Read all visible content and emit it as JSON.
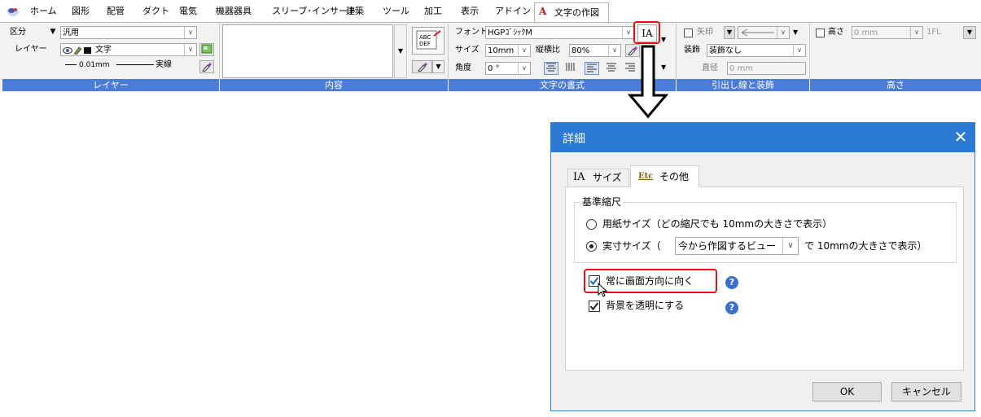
{
  "menu": {
    "tabs": [
      "ホーム",
      "図形",
      "配管",
      "ダクト",
      "電気",
      "機器器具",
      "スリーブ･インサート",
      "建築",
      "ツール",
      "加工",
      "表示",
      "アドイン"
    ],
    "active_tab_icon": "A",
    "active_tab": "文字の作図"
  },
  "ribbon": {
    "layer": {
      "kubun_label": "区分",
      "kubun_value": "汎用",
      "layer_label": "レイヤー",
      "layer_value": "文字",
      "line_width": "0.01mm",
      "line_type": "実線",
      "footer": "レイヤー"
    },
    "content": {
      "footer": "内容",
      "abc_icon_text": "ABC DEF"
    },
    "format": {
      "font_label": "フォント",
      "font_value": "HGPｺﾞｼｯｸM",
      "size_label": "サイズ",
      "size_value": "10mm",
      "ratio_label": "縦横比",
      "ratio_value": "80%",
      "angle_label": "角度",
      "angle_value": "0 °",
      "detail_button": "IA",
      "footer": "文字の書式"
    },
    "leader": {
      "arrow_label": "矢印",
      "deco_label": "装飾",
      "deco_value": "装飾なし",
      "diameter_label": "直径",
      "diameter_value": "0 mm",
      "footer": "引出し線と装飾"
    },
    "height": {
      "label": "高さ",
      "value": "0 mm",
      "floor": "1FL",
      "footer": "高さ"
    }
  },
  "dialog": {
    "title": "詳細",
    "close": "✕",
    "tab_size_icon": "IA",
    "tab_size": "サイズ",
    "tab_other_icon": "Etc",
    "tab_other": "その他",
    "group_title": "基準縮尺",
    "radio1": "用紙サイズ（どの縮尺でも 10mmの大きさで表示）",
    "radio2_prefix": "実寸サイズ（",
    "radio2_select": "今から作図するビュー",
    "radio2_suffix": "で 10mmの大きさで表示）",
    "check1": "常に画面方向に向く",
    "check2": "背景を透明にする",
    "help": "?",
    "ok": "OK",
    "cancel": "キャンセル"
  },
  "colors": {
    "accent": "#2a7ad3",
    "ribbon_footer": "#4a7cd9",
    "highlight": "#e8101a"
  }
}
